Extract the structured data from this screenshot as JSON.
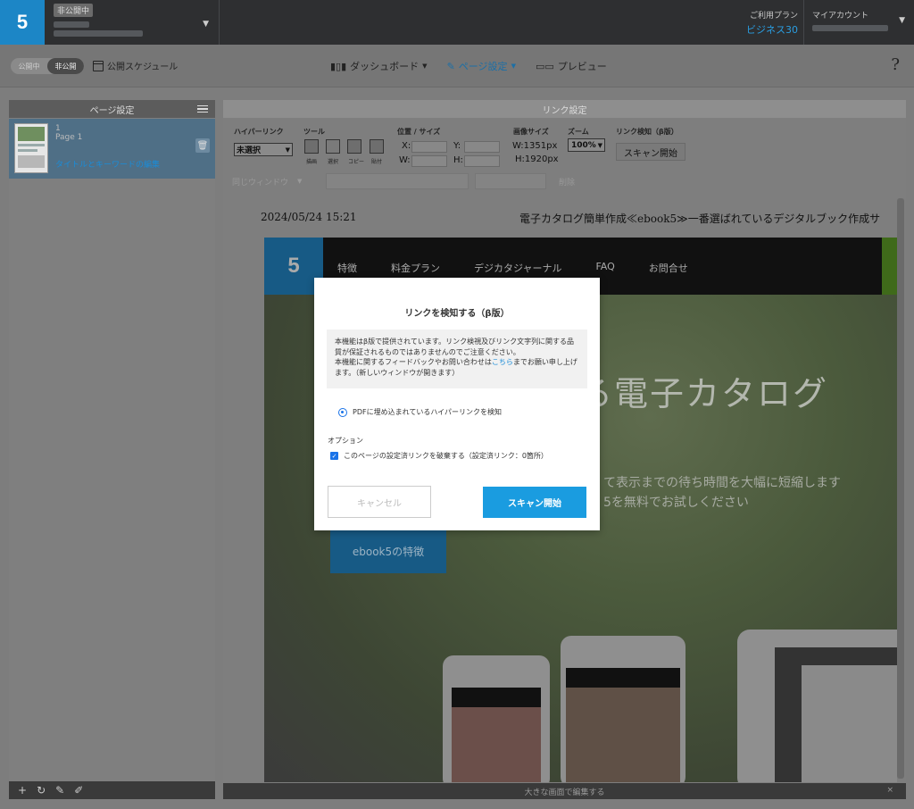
{
  "app": {
    "logo_text": "5",
    "book_status": "非公開中"
  },
  "header": {
    "plan_label": "ご利用プラン",
    "plan_value": "ビジネス30",
    "account_label": "マイアカウント"
  },
  "toolbar": {
    "toggle_public": "公開中",
    "toggle_private": "非公開",
    "schedule_label": "公開スケジュール",
    "nav": [
      {
        "label": "ダッシュボード"
      },
      {
        "label": "ページ設定"
      },
      {
        "label": "プレビュー"
      }
    ],
    "help": "?"
  },
  "left_panel": {
    "title": "ページ設定",
    "page_number": "1",
    "page_name": "Page 1",
    "page_link": "タイトルとキーワードの編集"
  },
  "right_panel": {
    "title": "リンク設定",
    "groups": {
      "hyperlink": "ハイパーリンク",
      "tools": "ツール",
      "position": "位置 / サイズ",
      "image_size": "画像サイズ",
      "zoom": "ズーム",
      "detect": "リンク検知（β版）"
    },
    "hyperlink_select": "未選択",
    "tool_labels": [
      "描画",
      "選択",
      "コピー",
      "貼付"
    ],
    "x_label": "X:",
    "y_label": "Y:",
    "w_label": "W:",
    "h_label": "H:",
    "img_w": "W:1351px",
    "img_h": "H:1920px",
    "zoom_value": "100%",
    "scan_button": "スキャン開始",
    "window_select": "同じウィンドウ",
    "delete_label": "削除",
    "footer": "大きな画面で編集する",
    "footer_close": "×"
  },
  "document": {
    "date": "2024/05/24 15:21",
    "title": "電子カタログ簡単作成≪ebook5≫一番選ばれているデジタルブック作成サ",
    "site_logo": "5",
    "site_nav": [
      "特徴",
      "料金プラン",
      "デジカタジャーナル",
      "FAQ",
      "お問合せ"
    ],
    "hero_title": "る電子カタログ",
    "hero_sub1": "て表示までの待ち時間を大幅に短縮します",
    "hero_sub2": "5を無料でお試しください",
    "hero_button": "ebook5の特徴"
  },
  "modal": {
    "title": "リンクを検知する（β版）",
    "note_line1": "本機能はβ版で提供されています。リンク検視及びリンク文字列に関する品質が保証されるものではありませんのでご注意ください。",
    "note_line2_pre": "本機能に関するフィードバックやお問い合わせは",
    "note_link": "こちら",
    "note_line2_post": "までお願い申し上げます。（新しいウィンドウが開きます）",
    "radio_label": "PDFに埋め込まれているハイパーリンクを検知",
    "option_label": "オプション",
    "checkbox_label": "このページの設定済リンクを破棄する（設定済リンク：0箇所）",
    "cancel_button": "キャンセル",
    "scan_button": "スキャン開始"
  }
}
